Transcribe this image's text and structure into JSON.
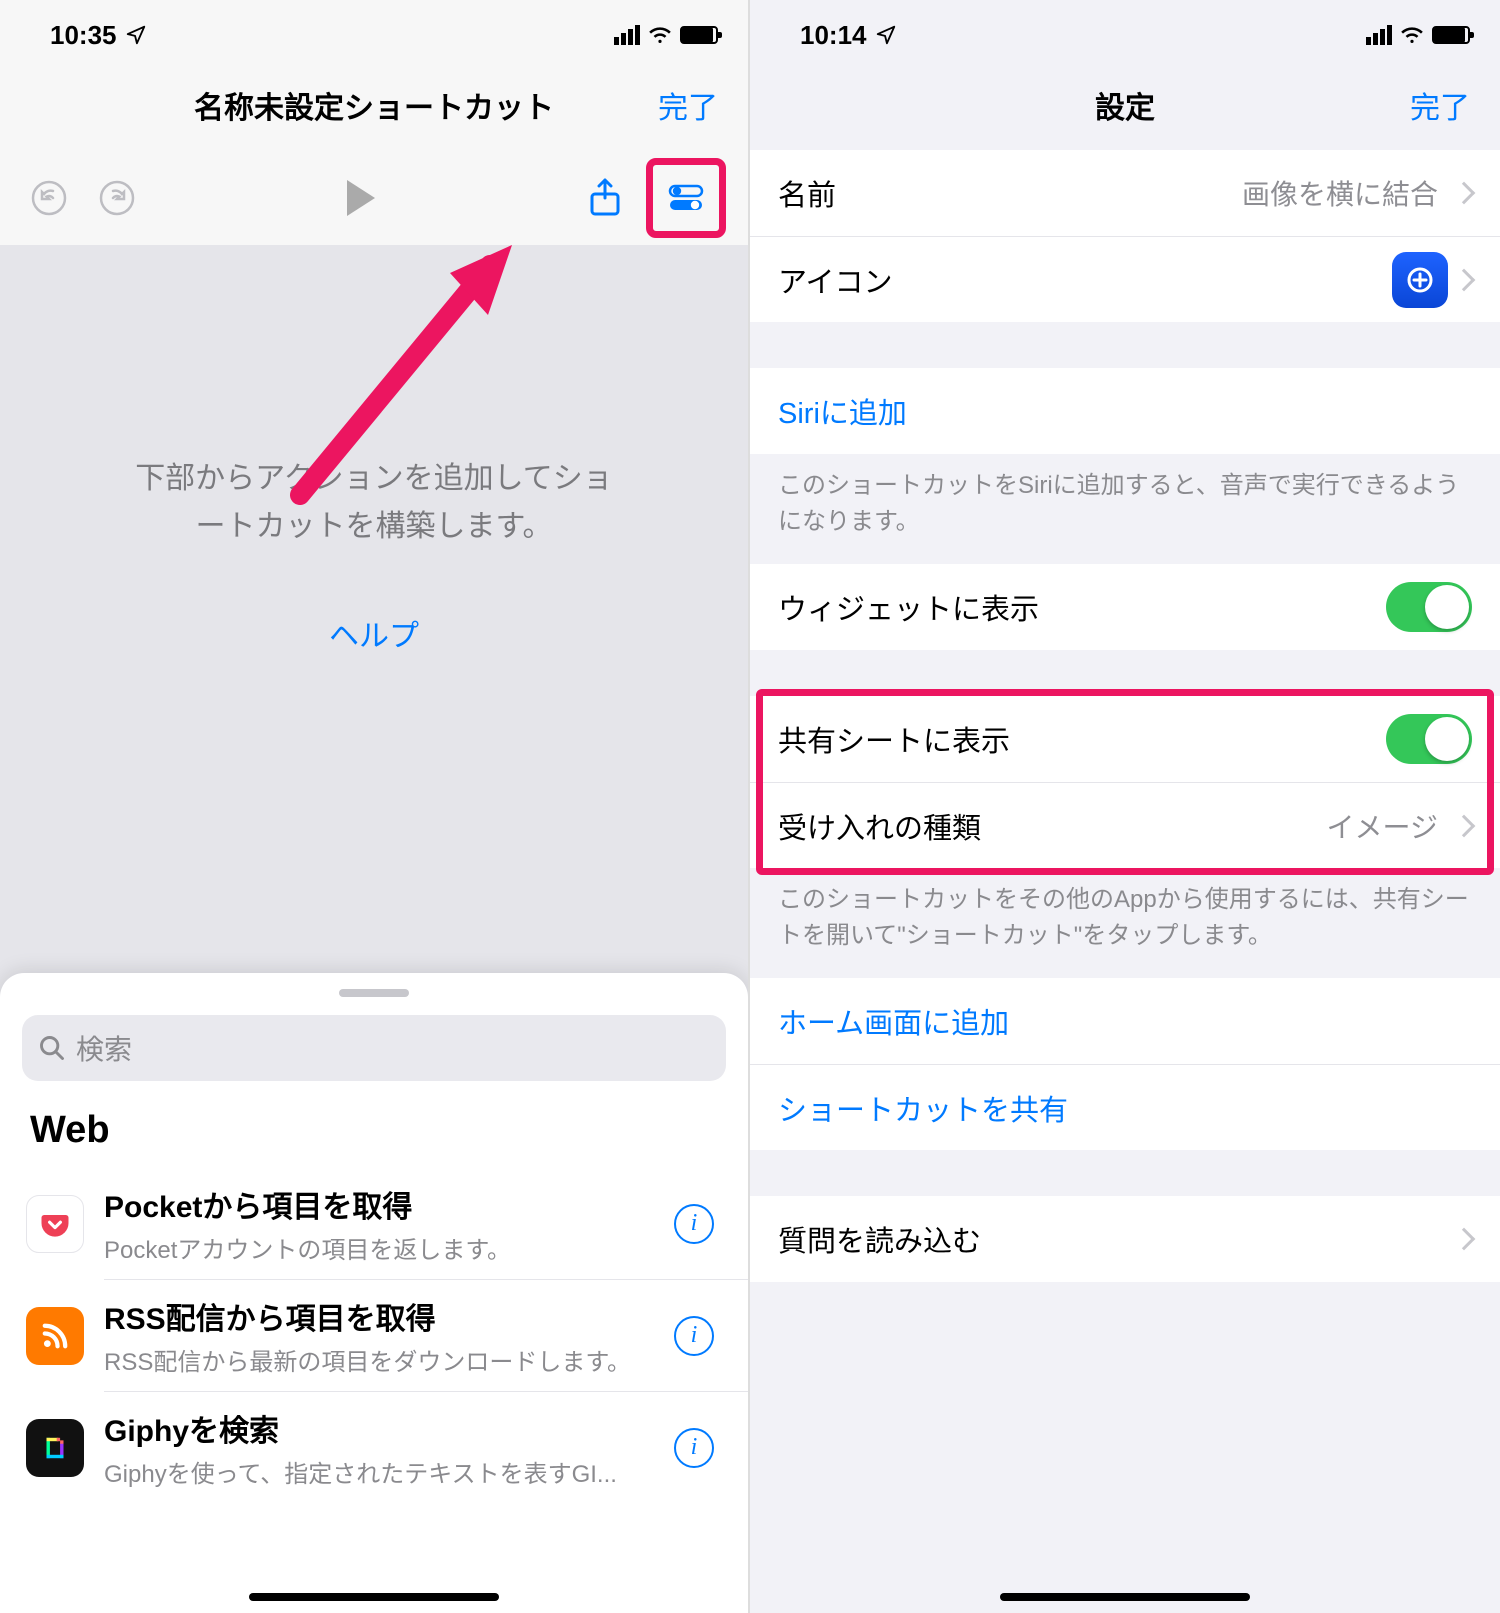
{
  "left": {
    "status": {
      "time": "10:35"
    },
    "nav": {
      "title": "名称未設定ショートカット",
      "done": "完了"
    },
    "canvas": {
      "line1": "下部からアクションを追加してショ",
      "line2": "ートカットを構築します。",
      "help": "ヘルプ"
    },
    "sheet": {
      "search_placeholder": "検索",
      "section": "Web",
      "actions": [
        {
          "title": "Pocketから項目を取得",
          "sub": "Pocketアカウントの項目を返します。"
        },
        {
          "title": "RSS配信から項目を取得",
          "sub": "RSS配信から最新の項目をダウンロードします。"
        },
        {
          "title": "Giphyを検索",
          "sub": "Giphyを使って、指定されたテキストを表すGI..."
        }
      ]
    }
  },
  "right": {
    "status": {
      "time": "10:14"
    },
    "nav": {
      "title": "設定",
      "done": "完了"
    },
    "rows": {
      "name_label": "名前",
      "name_value": "画像を横に結合",
      "icon_label": "アイコン",
      "siri_label": "Siriに追加",
      "siri_footer": "このショートカットをSiriに追加すると、音声で実行できるようになります。",
      "widget_label": "ウィジェットに表示",
      "share_label": "共有シートに表示",
      "accept_label": "受け入れの種類",
      "accept_value": "イメージ",
      "share_footer": "このショートカットをその他のAppから使用するには、共有シートを開いて\"ショートカット\"をタップします。",
      "home_label": "ホーム画面に追加",
      "share_shortcut_label": "ショートカットを共有",
      "import_label": "質問を読み込む"
    }
  }
}
